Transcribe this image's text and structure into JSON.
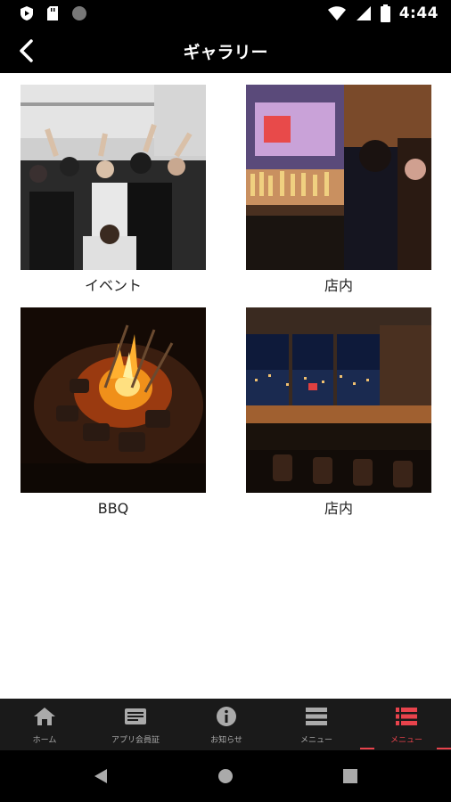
{
  "status_bar": {
    "time": "4:44"
  },
  "header": {
    "title": "ギャラリー"
  },
  "gallery": {
    "items": [
      {
        "caption": "イベント",
        "image": "party-crowd-photo"
      },
      {
        "caption": "店内",
        "image": "bar-counter-photo"
      },
      {
        "caption": "BBQ",
        "image": "bbq-fire-photo"
      },
      {
        "caption": "店内",
        "image": "night-view-bar-photo"
      }
    ]
  },
  "bottom_nav": {
    "tabs": [
      {
        "label": "ホーム",
        "icon": "home-icon"
      },
      {
        "label": "アプリ会員証",
        "icon": "member-card-icon"
      },
      {
        "label": "お知らせ",
        "icon": "info-icon"
      },
      {
        "label": "メニュー",
        "icon": "menu-list-icon"
      },
      {
        "label": "メニュー",
        "icon": "menu-list-icon",
        "active": true
      }
    ]
  },
  "colors": {
    "accent": "#e8434c",
    "header_bg": "#000000",
    "nav_bg": "#1a1a1a"
  }
}
